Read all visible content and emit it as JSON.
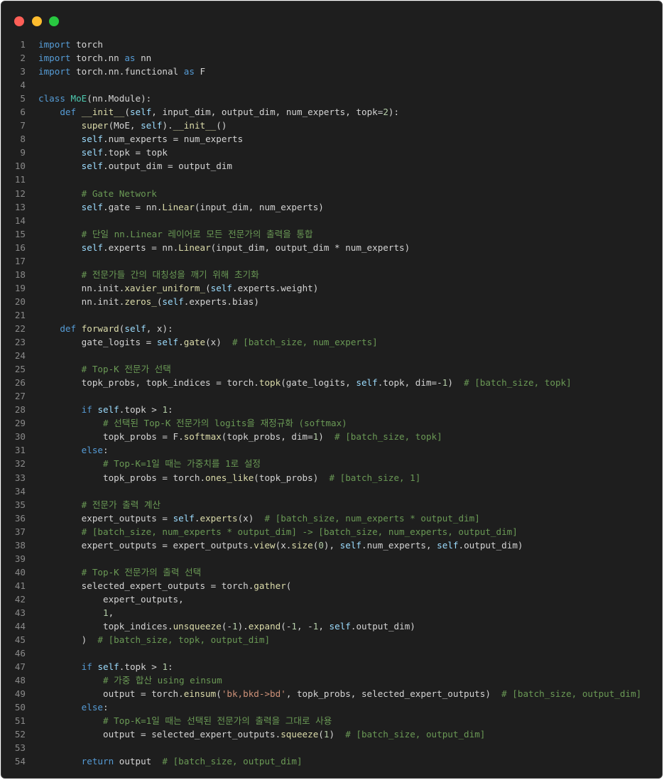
{
  "window": {
    "controls": [
      "close",
      "minimize",
      "maximize"
    ],
    "colors": {
      "close": "#fe5f57",
      "minimize": "#febc2e",
      "maximize": "#28c840",
      "background": "#1e1e1e"
    }
  },
  "code": {
    "language": "python",
    "lines": [
      "import torch",
      "import torch.nn as nn",
      "import torch.nn.functional as F",
      "",
      "class MoE(nn.Module):",
      "    def __init__(self, input_dim, output_dim, num_experts, topk=2):",
      "        super(MoE, self).__init__()",
      "        self.num_experts = num_experts",
      "        self.topk = topk",
      "        self.output_dim = output_dim",
      "",
      "        # Gate Network",
      "        self.gate = nn.Linear(input_dim, num_experts)",
      "",
      "        # 단일 nn.Linear 레이어로 모든 전문가의 출력을 통합",
      "        self.experts = nn.Linear(input_dim, output_dim * num_experts)",
      "",
      "        # 전문가들 간의 대칭성을 깨기 위해 초기화",
      "        nn.init.xavier_uniform_(self.experts.weight)",
      "        nn.init.zeros_(self.experts.bias)",
      "",
      "    def forward(self, x):",
      "        gate_logits = self.gate(x)  # [batch_size, num_experts]",
      "",
      "        # Top-K 전문가 선택",
      "        topk_probs, topk_indices = torch.topk(gate_logits, self.topk, dim=-1)  # [batch_size, topk]",
      "",
      "        if self.topk > 1:",
      "            # 선택된 Top-K 전문가의 logits을 재정규화 (softmax)",
      "            topk_probs = F.softmax(topk_probs, dim=1)  # [batch_size, topk]",
      "        else:",
      "            # Top-K=1일 때는 가중치를 1로 설정",
      "            topk_probs = torch.ones_like(topk_probs)  # [batch_size, 1]",
      "",
      "        # 전문가 출력 계산",
      "        expert_outputs = self.experts(x)  # [batch_size, num_experts * output_dim]",
      "        # [batch_size, num_experts * output_dim] -> [batch_size, num_experts, output_dim]",
      "        expert_outputs = expert_outputs.view(x.size(0), self.num_experts, self.output_dim)",
      "",
      "        # Top-K 전문가의 출력 선택",
      "        selected_expert_outputs = torch.gather(",
      "            expert_outputs,",
      "            1,",
      "            topk_indices.unsqueeze(-1).expand(-1, -1, self.output_dim)",
      "        )  # [batch_size, topk, output_dim]",
      "",
      "        if self.topk > 1:",
      "            # 가중 합산 using einsum",
      "            output = torch.einsum('bk,bkd->bd', topk_probs, selected_expert_outputs)  # [batch_size, output_dim]",
      "        else:",
      "            # Top-K=1일 때는 선택된 전문가의 출력을 그대로 사용",
      "            output = selected_expert_outputs.squeeze(1)  # [batch_size, output_dim]",
      "",
      "        return output  # [batch_size, output_dim]"
    ]
  }
}
